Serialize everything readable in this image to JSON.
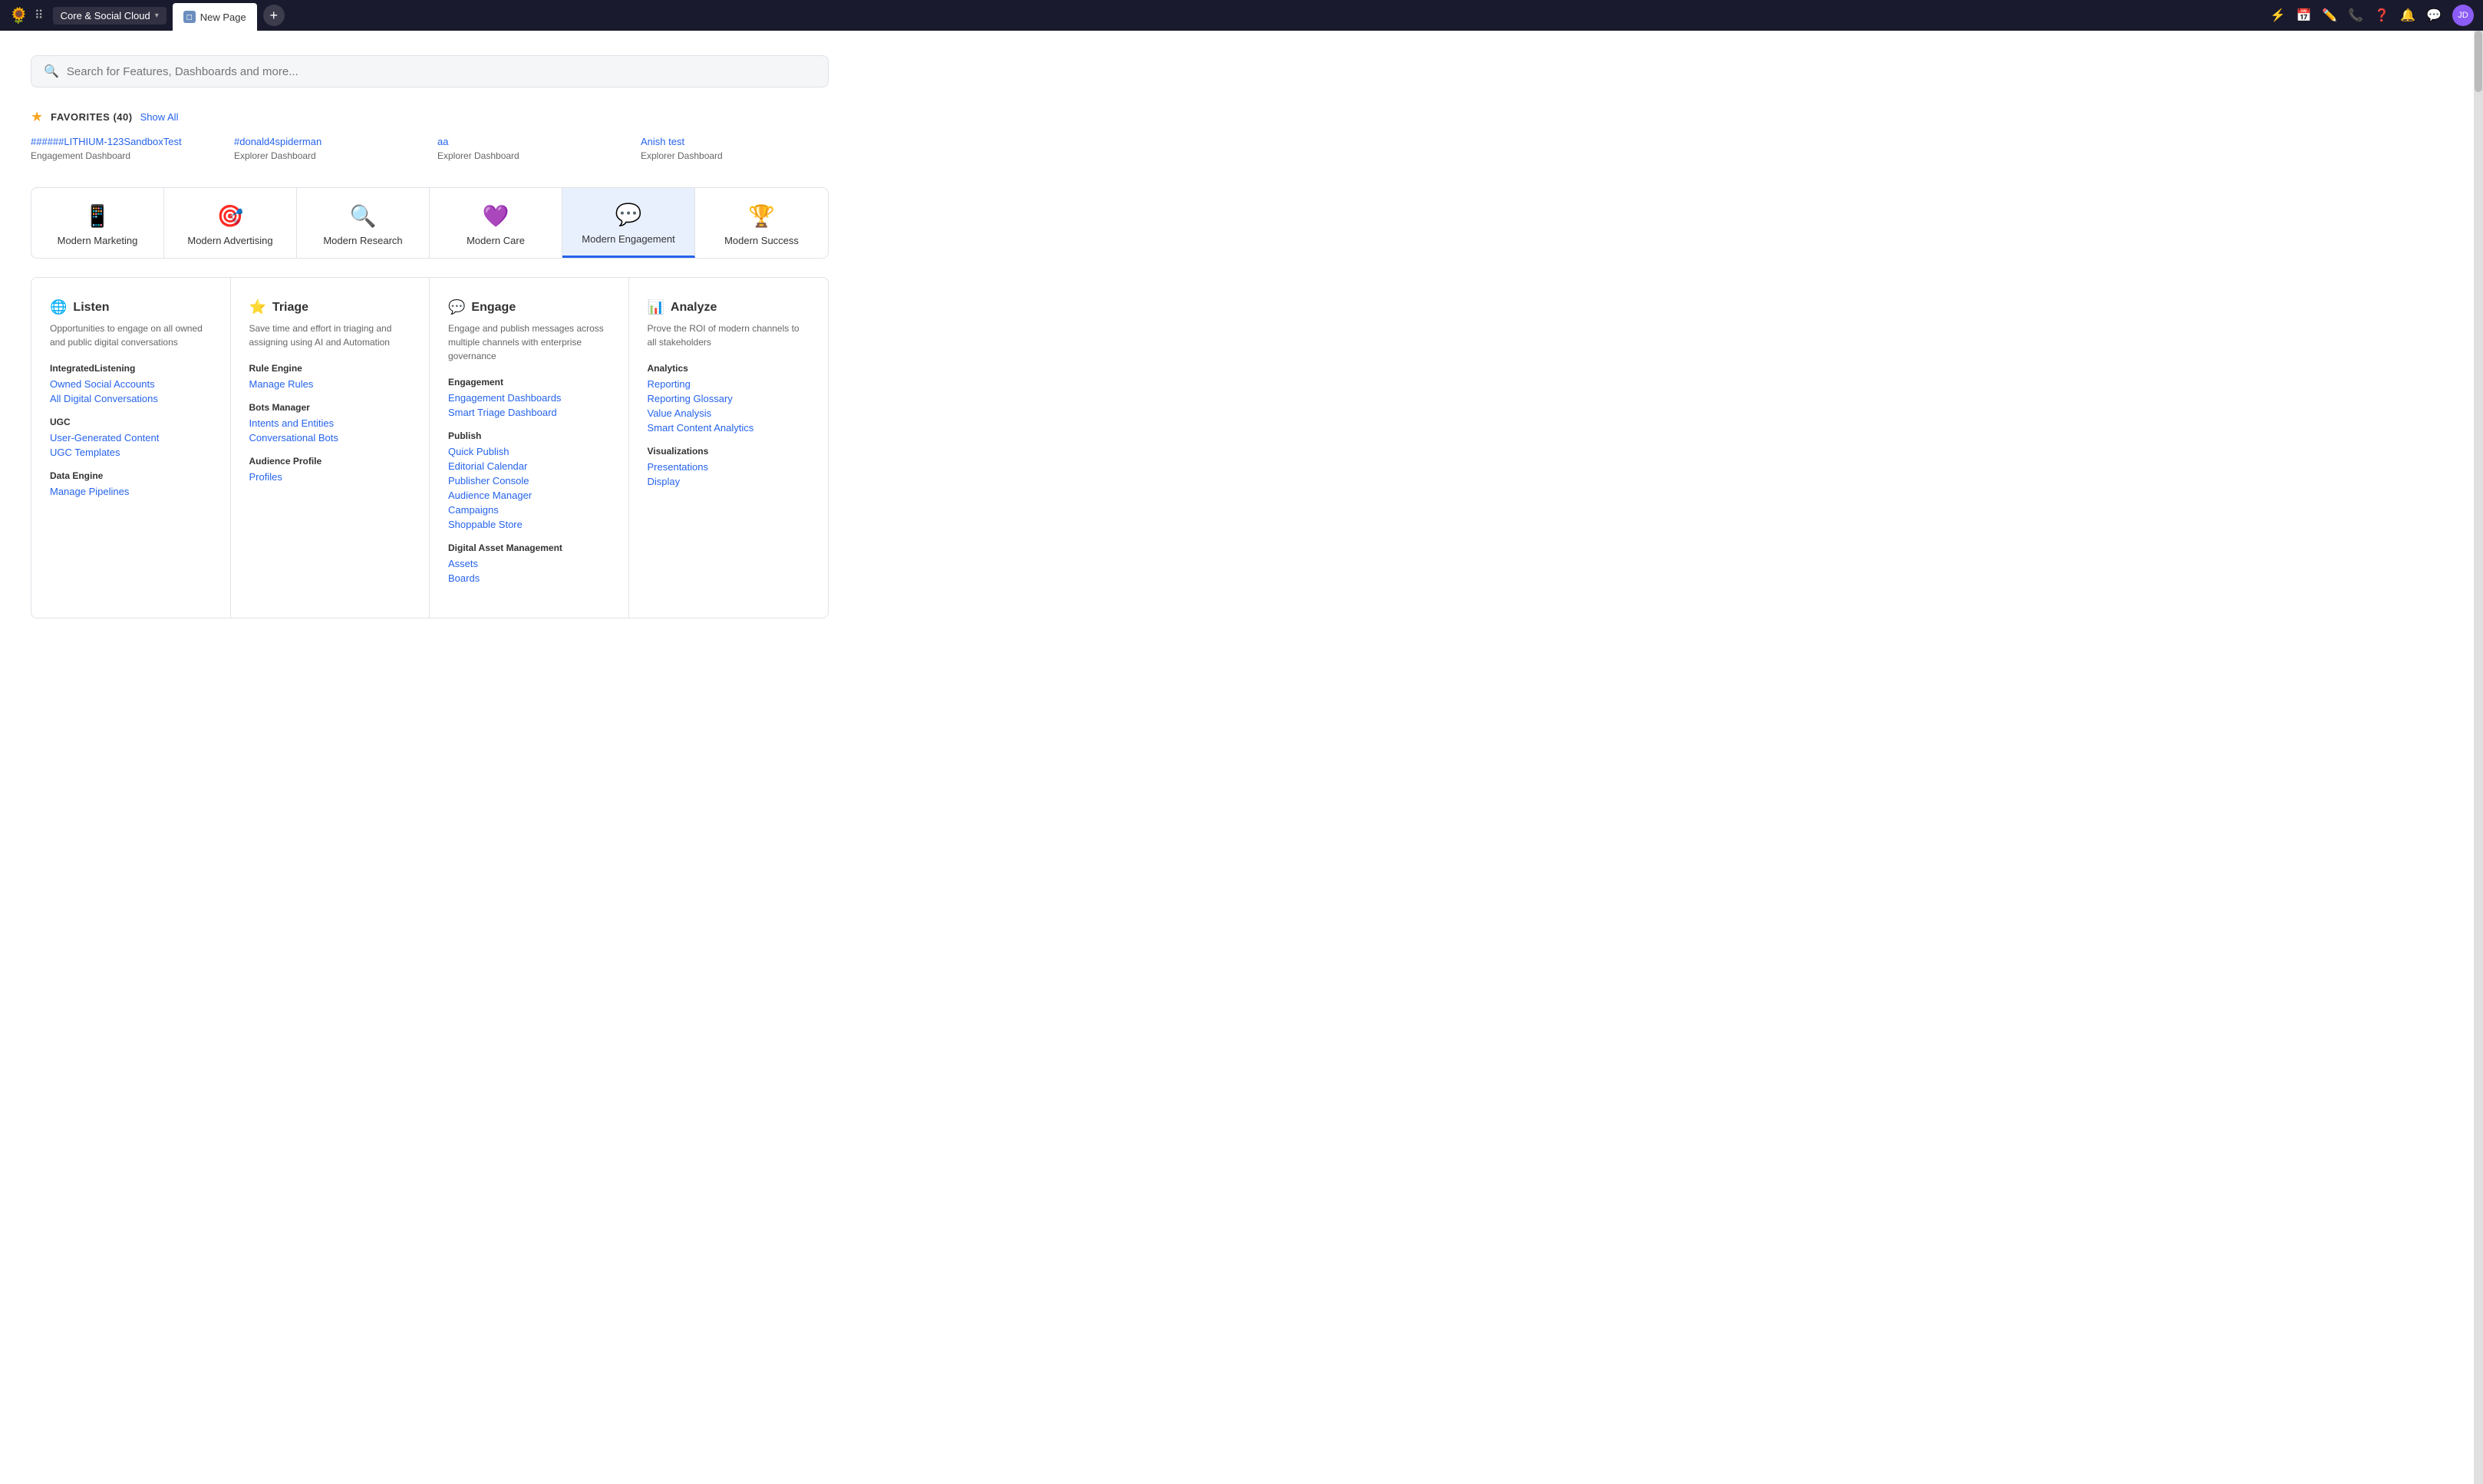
{
  "topnav": {
    "app_name": "Core & Social Cloud",
    "tab_label": "New Page",
    "add_btn": "+",
    "icons": [
      "⚡",
      "📅",
      "✏️",
      "📞",
      "?",
      "🔔",
      "💬"
    ],
    "avatar_initials": "JD"
  },
  "search": {
    "placeholder": "Search for Features, Dashboards and more..."
  },
  "favorites": {
    "title": "FAVORITES (40)",
    "show_all": "Show All",
    "items": [
      {
        "link": "######LITHIUM-123SandboxTest",
        "sub": "Engagement Dashboard"
      },
      {
        "link": "#donald4spiderman",
        "sub": "Explorer Dashboard"
      },
      {
        "link": "aa",
        "sub": "Explorer Dashboard"
      },
      {
        "link": "Anish test",
        "sub": "Explorer Dashboard"
      }
    ]
  },
  "modules": [
    {
      "id": "marketing",
      "icon": "📱",
      "icon_color": "#22c55e",
      "label": "Modern Marketing",
      "active": false
    },
    {
      "id": "advertising",
      "icon": "🎯",
      "icon_color": "#ec4899",
      "label": "Modern Advertising",
      "active": false
    },
    {
      "id": "research",
      "icon": "🔍",
      "icon_color": "#f59e0b",
      "label": "Modern Research",
      "active": false
    },
    {
      "id": "care",
      "icon": "💜",
      "icon_color": "#8b5cf6",
      "label": "Modern Care",
      "active": false
    },
    {
      "id": "engagement",
      "icon": "💬",
      "icon_color": "#3b82f6",
      "label": "Modern Engagement",
      "active": true
    },
    {
      "id": "success",
      "icon": "🏆",
      "icon_color": "#6b7280",
      "label": "Modern Success",
      "active": false
    }
  ],
  "columns": [
    {
      "id": "listen",
      "icon": "🌐",
      "icon_color": "#3b82f6",
      "title": "Listen",
      "desc": "Opportunities to engage on all owned and public digital conversations",
      "groups": [
        {
          "title": "IntegratedListening",
          "links": [
            "Owned Social Accounts",
            "All Digital Conversations"
          ]
        },
        {
          "title": "UGC",
          "links": [
            "User-Generated Content",
            "UGC Templates"
          ]
        },
        {
          "title": "Data Engine",
          "links": [
            "Manage Pipelines"
          ]
        }
      ]
    },
    {
      "id": "triage",
      "icon": "⭐",
      "icon_color": "#f59e0b",
      "title": "Triage",
      "desc": "Save time and effort in triaging and assigning using AI and Automation",
      "groups": [
        {
          "title": "Rule Engine",
          "links": [
            "Manage Rules"
          ]
        },
        {
          "title": "Bots Manager",
          "links": [
            "Intents and Entities",
            "Conversational Bots"
          ]
        },
        {
          "title": "Audience Profile",
          "links": [
            "Profiles"
          ]
        }
      ]
    },
    {
      "id": "engage",
      "icon": "💬",
      "icon_color": "#3b82f6",
      "title": "Engage",
      "desc": "Engage and publish messages across multiple channels with enterprise governance",
      "groups": [
        {
          "title": "Engagement",
          "links": [
            "Engagement Dashboards",
            "Smart Triage Dashboard"
          ]
        },
        {
          "title": "Publish",
          "links": [
            "Quick Publish",
            "Editorial Calendar",
            "Publisher Console",
            "Audience Manager",
            "Campaigns",
            "Shoppable Store"
          ]
        },
        {
          "title": "Digital Asset Management",
          "links": [
            "Assets",
            "Boards"
          ]
        }
      ]
    },
    {
      "id": "analyze",
      "icon": "📊",
      "icon_color": "#3b82f6",
      "title": "Analyze",
      "desc": "Prove the ROI of modern channels to all stakeholders",
      "groups": [
        {
          "title": "Analytics",
          "links": [
            "Reporting",
            "Reporting Glossary",
            "Value Analysis",
            "Smart Content Analytics"
          ]
        },
        {
          "title": "Visualizations",
          "links": [
            "Presentations",
            "Display"
          ]
        }
      ]
    }
  ]
}
